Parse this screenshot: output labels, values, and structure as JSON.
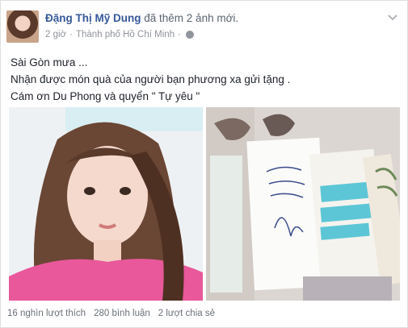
{
  "post": {
    "author": "Đặng Thị Mỹ Dung",
    "action": "đã thêm 2 ảnh mới.",
    "time": "2 giờ",
    "separator": "·",
    "location": "Thành phố Hồ Chí Minh",
    "separator2": "·",
    "text_lines": [
      "Sài Gòn mưa ...",
      "Nhận được món quà của người bạn phương xa gửi tặng .",
      "Cám ơn Du Phong và quyển \" Tự yêu \""
    ]
  },
  "stats": {
    "likes": "16 nghìn lượt thích",
    "comments": "280 bình luận",
    "shares": "2 lượt chia sẻ"
  },
  "icons": {
    "privacy": "globe-icon",
    "menu": "chevron-down-icon"
  },
  "colors": {
    "author": "#365899",
    "meta": "#90949c",
    "border": "#dddfe2",
    "shirt": "#e8589a",
    "book_cover": "#5cc6d6"
  }
}
